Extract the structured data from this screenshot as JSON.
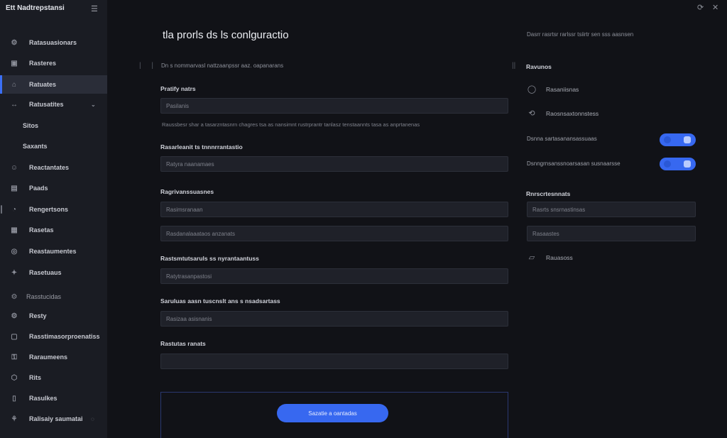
{
  "app": {
    "brand": "Ett Nadtrepstansi"
  },
  "sidebar": {
    "items": [
      {
        "label": "Ratasuasionars",
        "icon": "bell-icon"
      },
      {
        "label": "Rasteres",
        "icon": "grid-icon"
      },
      {
        "label": "Ratuates",
        "icon": "home-icon",
        "active": true
      },
      {
        "label": "Ratusatites",
        "icon": "arrow-icon",
        "expanded": true
      },
      {
        "label": "Sitos"
      },
      {
        "label": "Saxants"
      },
      {
        "label": "Reactantates",
        "icon": "users-icon"
      },
      {
        "label": "Paads",
        "icon": "file-icon"
      },
      {
        "label": "Rengertsons",
        "icon": "chart-icon"
      },
      {
        "label": "Rasetas",
        "icon": "calendar-icon"
      },
      {
        "label": "Reastaumentes",
        "icon": "globe-icon"
      },
      {
        "label": "Rasetuaus",
        "icon": "settings-icon"
      },
      {
        "label": "Rasstucidas",
        "icon": "shield-icon"
      },
      {
        "label": "Resty",
        "icon": "sliders-icon"
      },
      {
        "label": "Rasstimasorproenatiss",
        "icon": "folder-icon"
      },
      {
        "label": "Raraumeens",
        "icon": "key-icon"
      },
      {
        "label": "Rits",
        "icon": "box-icon"
      },
      {
        "label": "Rasulkes",
        "icon": "lock-icon"
      },
      {
        "label": "Ralisaiy saumatai",
        "icon": "question-icon"
      }
    ]
  },
  "main": {
    "title": "tla prorls ds ls conlguractio",
    "section_label": "Dn s nommarvasl nattzaanpssr aaz. oapanarans",
    "help_text": "Raussbesr shar a tasarzntasnrn chagres tsa as nansimnt rustrprantr tanlasz tenstaannts tasa as anprtanenas",
    "fields": [
      {
        "label": "Pratify natrs",
        "value": "Pasilanis"
      },
      {
        "label": "Rasarleanit ts tnnnrrantastio",
        "value": "Ratyra naanamaes"
      },
      {
        "label": "Ragrivanssuasnes",
        "value": "Rasimsranaan"
      },
      {
        "label": "",
        "value": "Rasdanalaaataos anzanats"
      },
      {
        "label": "Rastsmtutsaruls ss nyrantaantuss",
        "value": "Ratytrasanpastosi"
      },
      {
        "label": "Saruluas aasn tuscnslt ans s nsadsartass",
        "value": "Rasizaa asisnanis"
      },
      {
        "label": "Rastutas ranats",
        "value": ""
      }
    ],
    "submit_label": "Sazatie a oantadas"
  },
  "right_panel": {
    "heading": "Dasrr rasrtsr rarlssr tsiirtr sen sss aasnsen",
    "section_label": "Ravunos",
    "rows": [
      {
        "label": "Rasaniisnas",
        "icon": "info-icon"
      },
      {
        "label": "Raosnsaxtonnstess",
        "icon": "refresh-icon"
      }
    ],
    "toggles": [
      {
        "label": "Dsnna sartasanansassuaas",
        "on": true
      },
      {
        "label": "Dsnngrnsanssnoarsasan susnaarsse",
        "on": true
      }
    ],
    "section2_label": "Rnrscrtesnnats",
    "fields": [
      {
        "value": "Rasrts snsrnastinsas"
      },
      {
        "value": "Rasaastes"
      }
    ],
    "doc_row": {
      "label": "Rauasoss",
      "icon": "document-icon"
    }
  }
}
